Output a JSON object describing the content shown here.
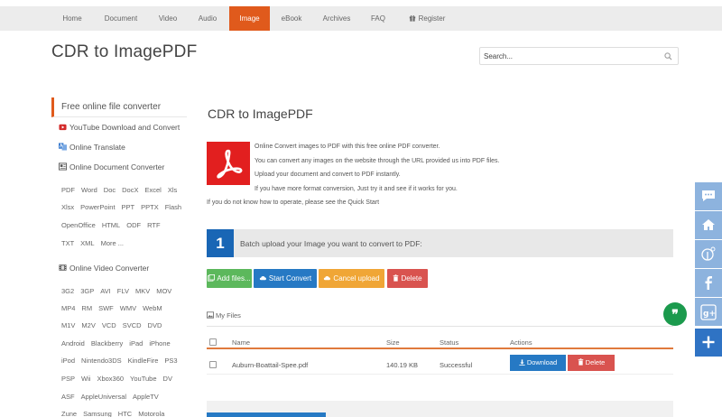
{
  "nav": {
    "items": [
      {
        "label": "Home",
        "active": false
      },
      {
        "label": "Document",
        "active": false
      },
      {
        "label": "Video",
        "active": false
      },
      {
        "label": "Audio",
        "active": false
      },
      {
        "label": "Image",
        "active": true
      },
      {
        "label": "eBook",
        "active": false
      },
      {
        "label": "Archives",
        "active": false
      },
      {
        "label": "FAQ",
        "active": false
      },
      {
        "label": "Register",
        "active": false,
        "icon": "gift-icon"
      }
    ]
  },
  "header": {
    "title": "CDR to ImagePDF",
    "search_placeholder": "Search..."
  },
  "sidebar": {
    "active_item": "Free online file converter",
    "links": [
      {
        "label": "YouTube Download and Convert",
        "icon": "youtube-icon"
      },
      {
        "label": "Online Translate",
        "icon": "translate-icon"
      },
      {
        "label": "Online Document Converter",
        "icon": "document-icon"
      }
    ],
    "document_formats": [
      [
        "PDF",
        "Word",
        "Doc",
        "DocX",
        "Excel",
        "Xls"
      ],
      [
        "Xlsx",
        "PowerPoint",
        "PPT",
        "PPTX",
        "Flash"
      ],
      [
        "OpenOffice",
        "HTML",
        "ODF",
        "RTF"
      ],
      [
        "TXT",
        "XML",
        "More ..."
      ]
    ],
    "video_link": {
      "label": "Online Video Converter",
      "icon": "film-icon"
    },
    "video_formats": [
      [
        "3G2",
        "3GP",
        "AVI",
        "FLV",
        "MKV",
        "MOV"
      ],
      [
        "MP4",
        "RM",
        "SWF",
        "WMV",
        "WebM"
      ],
      [
        "M1V",
        "M2V",
        "VCD",
        "SVCD",
        "DVD"
      ],
      [
        "Android",
        "Blackberry",
        "iPad",
        "iPhone"
      ],
      [
        "iPod",
        "Nintendo3DS",
        "KindleFire",
        "PS3"
      ],
      [
        "PSP",
        "Wii",
        "Xbox360",
        "YouTube",
        "DV"
      ],
      [
        "ASF",
        "AppleUniversal",
        "AppleTV"
      ],
      [
        "Zune",
        "Samsung",
        "HTC",
        "Motorola"
      ]
    ]
  },
  "main": {
    "title": "CDR to ImagePDF",
    "description": [
      "Online Convert images to PDF with this free online PDF converter.",
      "You can convert any images on the website through the URL provided us into PDF files.",
      "Upload your document and convert to PDF instantly.",
      "If you have more format conversion, Just try it and see if it works for you."
    ],
    "quick_start_note": "If you do not know how to operate, please see the Quick Start",
    "step": {
      "number": "1",
      "text": "Batch upload your Image you want to convert to PDF:"
    },
    "buttons": {
      "add_files": "Add files...",
      "start_convert": "Start Convert",
      "cancel_upload": "Cancel upload",
      "delete": "Delete"
    },
    "my_files_label": "My Files",
    "table": {
      "headers": {
        "name": "Name",
        "size": "Size",
        "status": "Status",
        "actions": "Actions"
      },
      "rows": [
        {
          "name": "Auburn-Boattail-Spee.pdf",
          "size": "140.19 KB",
          "status": "Successful",
          "download": "Download",
          "delete": "Delete"
        }
      ]
    }
  },
  "social": [
    "comment-icon",
    "home-icon",
    "pinterest-icon",
    "facebook-icon",
    "google-plus-icon",
    "plus-icon"
  ],
  "colors": {
    "accent": "#e05a1c",
    "primary_blue": "#2679c4",
    "green": "#5cb85c",
    "orange": "#f0a636",
    "red": "#d9534f",
    "pdf_red": "#e21f1f",
    "step_blue": "#1966b5",
    "quote_green": "#1b9a4d"
  }
}
